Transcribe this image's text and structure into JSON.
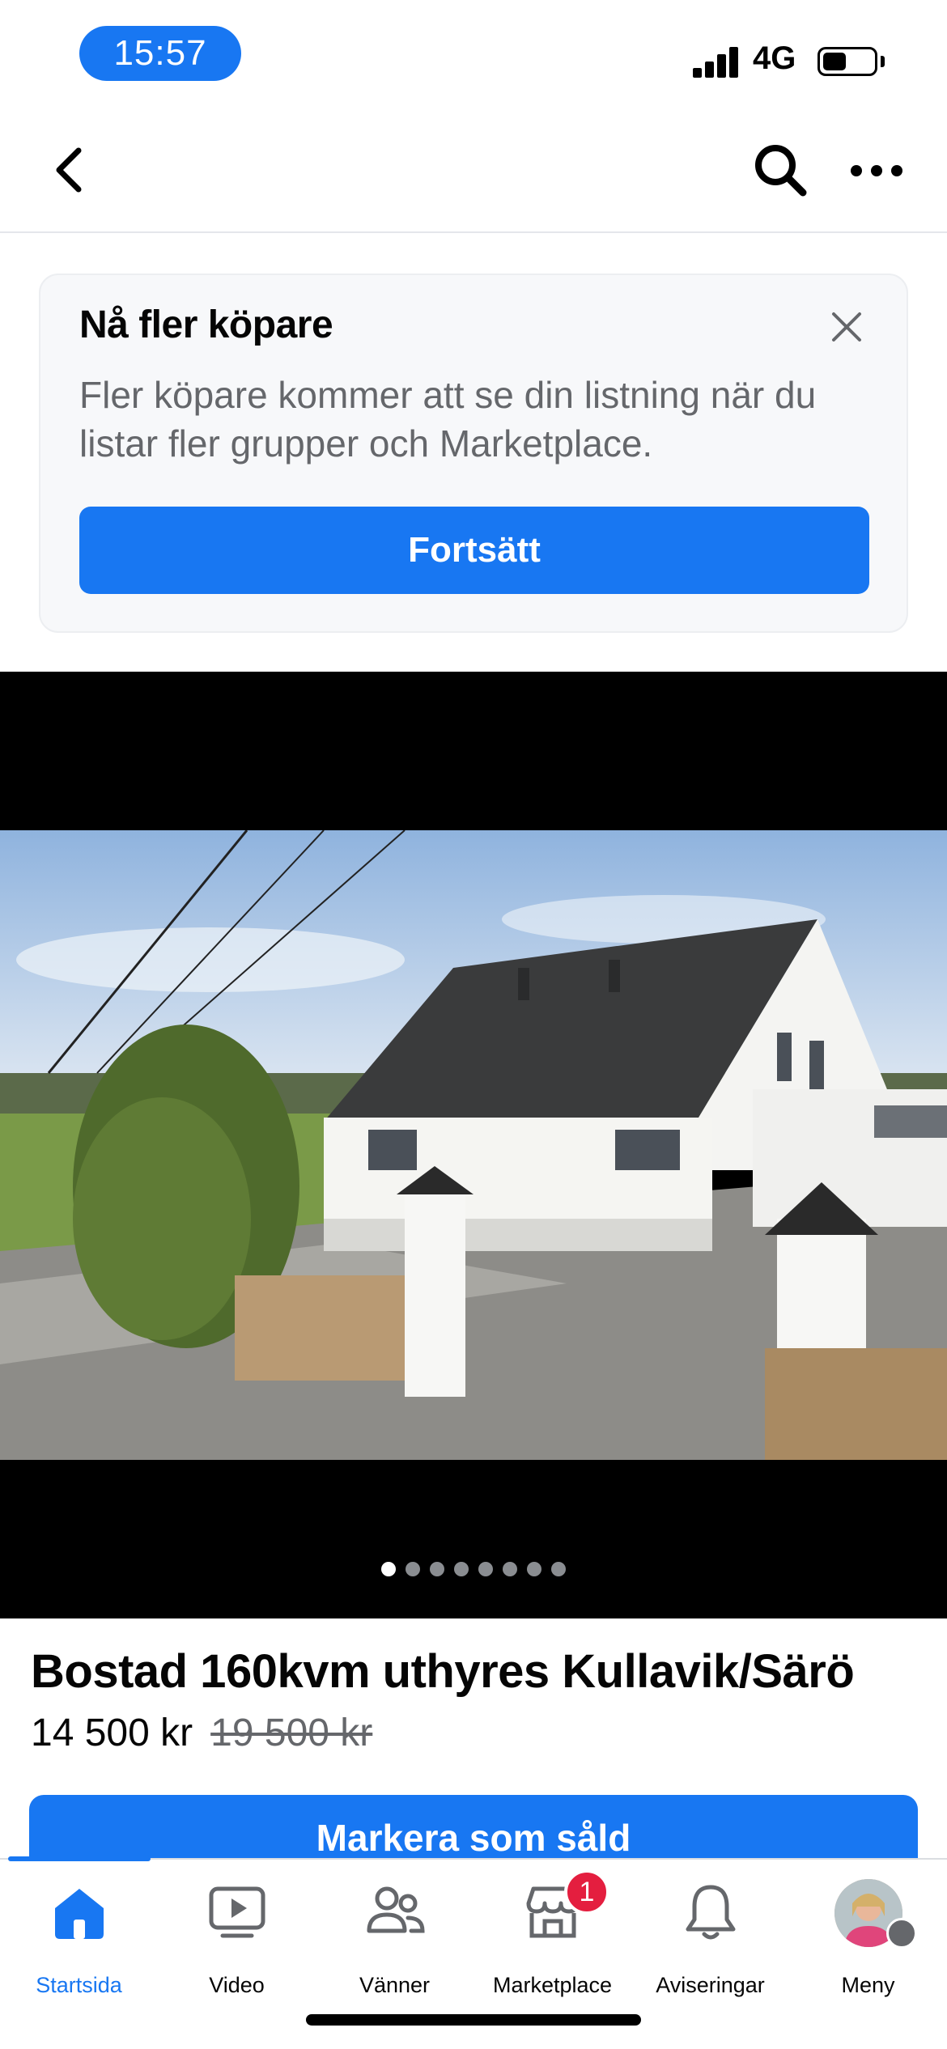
{
  "status_bar": {
    "time": "15:57",
    "network": "4G",
    "battery_level": 0.45
  },
  "nav": {
    "back_icon": "chevron-left-icon",
    "search_icon": "search-icon",
    "more_icon": "more-horizontal-icon"
  },
  "promo": {
    "title": "Nå fler köpare",
    "text": "Fler köpare kommer att se din listning när du listar fler grupper och Marketplace.",
    "button_label": "Fortsätt",
    "close_icon": "close-icon"
  },
  "gallery": {
    "photo_count": 8,
    "active_index": 0
  },
  "listing": {
    "title": "Bostad 160kvm uthyres Kullavik/Särö",
    "price": "14 500 kr",
    "old_price": "19 500 kr",
    "mark_sold_label": "Markera som såld"
  },
  "tabbar": {
    "accent": "#1877f2",
    "tabs": [
      {
        "label": "Startsida",
        "icon": "home-icon",
        "active": true
      },
      {
        "label": "Video",
        "icon": "video-icon",
        "active": false
      },
      {
        "label": "Vänner",
        "icon": "friends-icon",
        "active": false
      },
      {
        "label": "Marketplace",
        "icon": "marketplace-icon",
        "active": false,
        "badge": "1"
      },
      {
        "label": "Aviseringar",
        "icon": "bell-icon",
        "active": false
      },
      {
        "label": "Meny",
        "icon": "avatar-icon",
        "active": false
      }
    ]
  }
}
